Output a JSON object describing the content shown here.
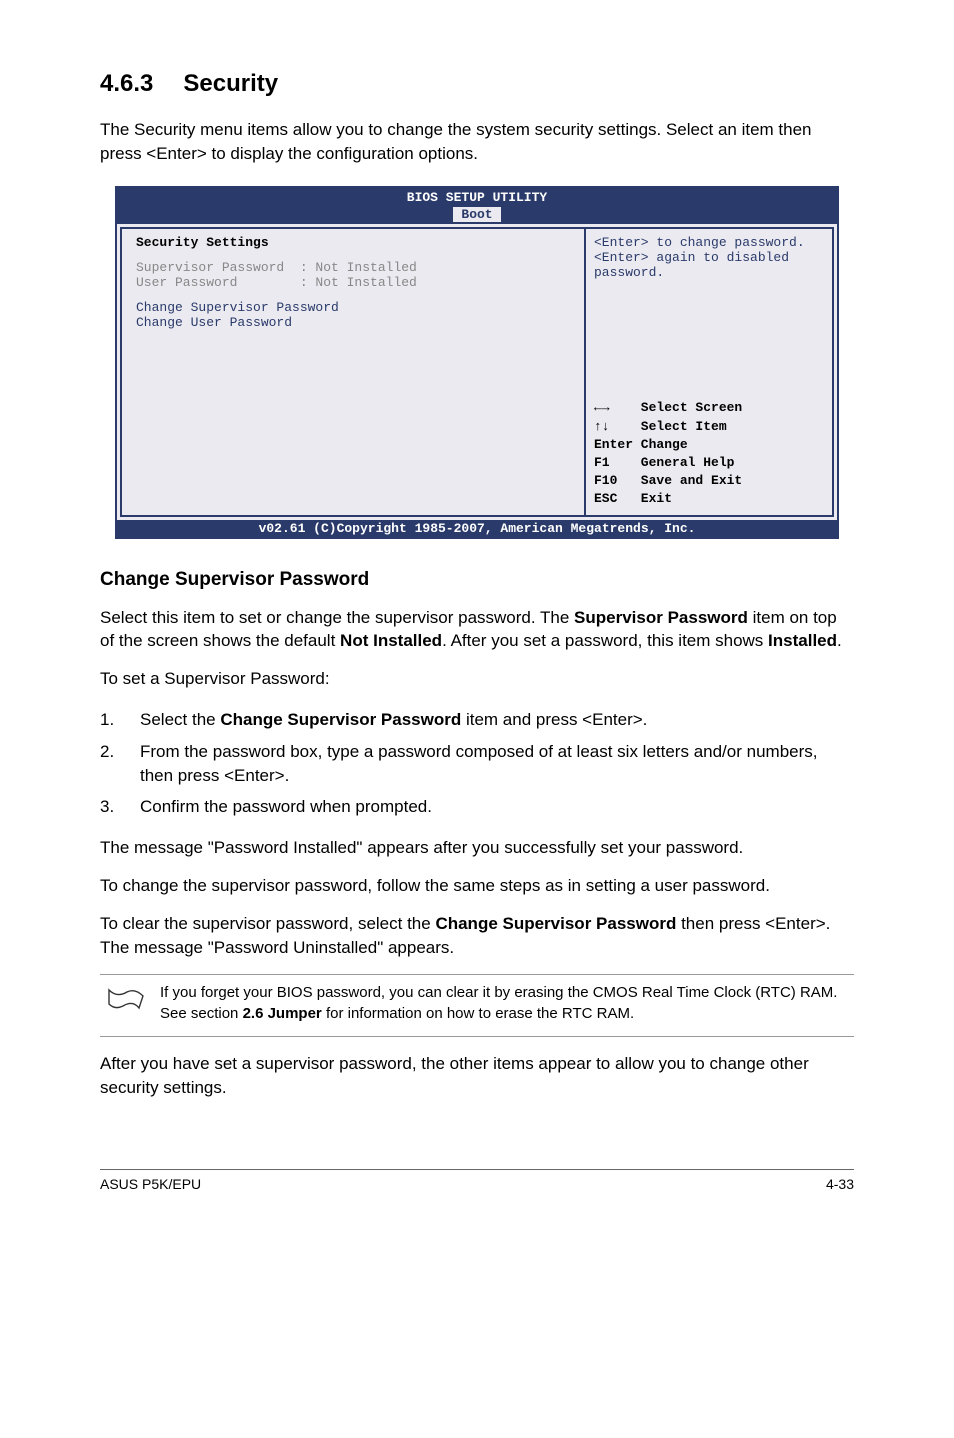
{
  "section": {
    "number": "4.6.3",
    "title": "Security"
  },
  "intro": "The Security menu items allow you to change the system security settings. Select an item then press <Enter> to display the configuration options.",
  "bios": {
    "headerTitle": "BIOS SETUP UTILITY",
    "tab": "Boot",
    "sectionTitle": "Security Settings",
    "supervisorLabel": "Supervisor Password  : Not Installed",
    "userLabel": "User Password        : Not Installed",
    "changeSupervisor": "Change Supervisor Password",
    "changeUser": "Change User Password",
    "helpText1": "<Enter> to change password.",
    "helpText2": "<Enter> again to disabled password.",
    "navKeys": "←→    Select Screen\n↑↓    Select Item\nEnter Change\nF1    General Help\nF10   Save and Exit\nESC   Exit",
    "footer": "v02.61 (C)Copyright 1985-2007, American Megatrends, Inc."
  },
  "subsection": {
    "heading": "Change Supervisor Password",
    "para1_a": "Select this item to set or change the supervisor password. The ",
    "para1_b": "Supervisor Password",
    "para1_c": " item on top of the screen shows the default ",
    "para1_d": "Not Installed",
    "para1_e": ". After you set a password, this item shows ",
    "para1_f": "Installed",
    "para1_g": ".",
    "para2": "To set a Supervisor Password:",
    "list": {
      "item1_a": "Select the ",
      "item1_b": "Change Supervisor Password",
      "item1_c": " item and press <Enter>.",
      "item2": "From the password box, type a password composed of at least six letters and/or numbers, then press <Enter>.",
      "item3": "Confirm the password when prompted."
    },
    "para3": "The message \"Password Installed\" appears after you successfully set your password.",
    "para4": "To change the supervisor password, follow the same steps as in setting a user password.",
    "para5_a": "To clear the supervisor password, select the ",
    "para5_b": "Change Supervisor Password",
    "para5_c": " then press <Enter>. The message \"Password Uninstalled\" appears.",
    "note_a": "If you forget your BIOS password, you can clear it by erasing the CMOS Real Time Clock (RTC) RAM. See section ",
    "note_b": "2.6 Jumper",
    "note_c": " for information on how to erase the RTC RAM.",
    "para6": "After you have set a supervisor password, the other items appear to allow you to change other security settings."
  },
  "footer": {
    "left": "ASUS P5K/EPU",
    "right": "4-33"
  }
}
